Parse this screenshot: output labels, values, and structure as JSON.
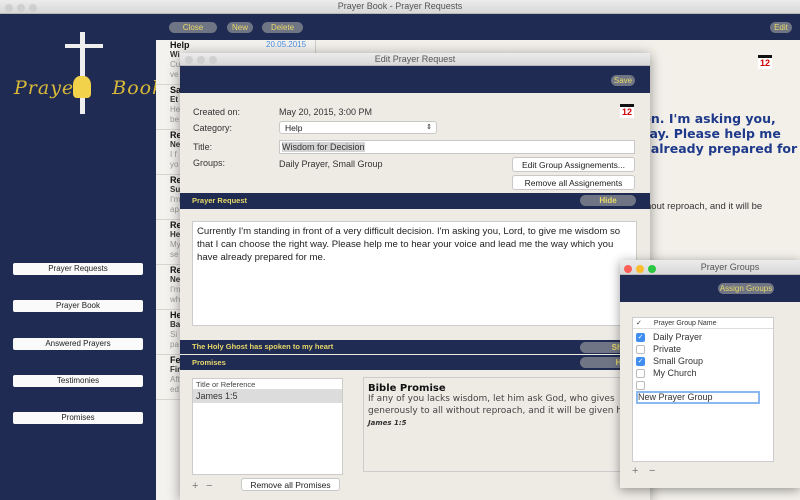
{
  "window": {
    "title": "Prayer Book - Prayer Requests"
  },
  "logo": {
    "text": "PrayerBook"
  },
  "toolbar": {
    "close": "Close",
    "new": "New",
    "delete": "Delete",
    "edit": "Edit"
  },
  "sidebar": {
    "items": [
      "Prayer Requests",
      "Prayer Book",
      "Answered Prayers",
      "Testimonies",
      "Promises"
    ]
  },
  "list": {
    "items": [
      {
        "t": "Help",
        "s": "Wi",
        "p1": "Cu",
        "p2": "ve",
        "date": "20.05.2015"
      },
      {
        "t": "Sa",
        "s": "Et",
        "p1": "He",
        "p2": "be"
      },
      {
        "t": "Re",
        "s": "Ne",
        "p1": "I f",
        "p2": "yo"
      },
      {
        "t": "Re",
        "s": "Su",
        "p1": "I'm",
        "p2": "ap"
      },
      {
        "t": "Re",
        "s": "He",
        "p1": "My",
        "p2": "se"
      },
      {
        "t": "Re",
        "s": "Ne",
        "p1": "I'm",
        "p2": "wh"
      },
      {
        "t": "He",
        "s": "Ba",
        "p1": "Si",
        "p2": "pa"
      },
      {
        "t": "Fe",
        "s": "Fir",
        "p1": "Aft",
        "p2": "ed"
      }
    ]
  },
  "background_detail": {
    "lines": [
      "ion. I'm asking you,",
      "way. Please help me",
      "e already prepared for"
    ],
    "promise_fragment": "hout reproach, and it will be",
    "calendar_day": "12"
  },
  "dialog": {
    "title": "Edit Prayer Request",
    "save": "Save",
    "created_label": "Created on:",
    "created_value": "May 20, 2015, 3:00 PM",
    "category_label": "Category:",
    "category_value": "Help",
    "title_label": "Title:",
    "title_value": "Wisdom for Decision",
    "groups_label": "Groups:",
    "groups_value": "Daily Prayer, Small Group",
    "edit_groups": "Edit Group Assignements...",
    "remove_assign": "Remove all Assignements",
    "calendar_day": "12",
    "prayer_section": "Prayer Request",
    "hide": "Hide",
    "prayer_text": "Currently I'm standing in front of a very difficult decision. I'm asking you, Lord, to give me wisdom so that I can choose the right way. Please help me to hear your voice and lead me the way which you have already prepared for me.",
    "holy_section": "The Holy Ghost has spoken to my heart",
    "show": "Show",
    "promises_section": "Promises",
    "promises_hide": "Hide",
    "promise_col": "Title or Reference",
    "promise_rows": [
      "James 1:5"
    ],
    "remove_promises": "Remove all Promises",
    "bible_title": "Bible Promise",
    "bible_text": "If any of you lacks wisdom, let him ask God, who gives generously to all without reproach, and it will be given him.",
    "bible_ref": "James 1:5"
  },
  "groups": {
    "title": "Prayer Groups",
    "assign": "Assign Groups",
    "col_check": "✓",
    "col_name": "Prayer Group Name",
    "rows": [
      {
        "name": "Daily Prayer",
        "checked": true
      },
      {
        "name": "Private",
        "checked": false
      },
      {
        "name": "Small Group",
        "checked": true
      },
      {
        "name": "My Church",
        "checked": false
      },
      {
        "name": "New Prayer Group",
        "checked": false
      }
    ]
  }
}
